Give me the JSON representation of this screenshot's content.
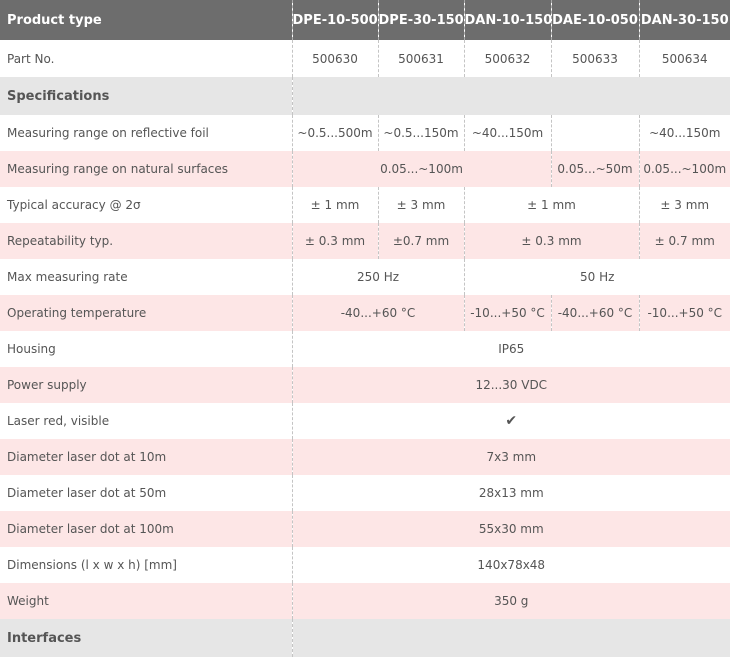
{
  "header": {
    "label": "Product type",
    "models": [
      "DPE-10-500",
      "DPE-30-150",
      "DAN-10-150",
      "DAE-10-050",
      "DAN-30-150"
    ]
  },
  "part_no": {
    "label": "Part No.",
    "values": [
      "500630",
      "500631",
      "500632",
      "500633",
      "500634"
    ]
  },
  "sections": {
    "specifications": "Specifications",
    "interfaces": "Interfaces"
  },
  "rows": {
    "reflective_range": {
      "label": "Measuring range on reflective foil",
      "v1": "~0.5...500m",
      "v2": "~0.5...150m",
      "v3": "~40...150m",
      "v4": "",
      "v5": "~40...150m"
    },
    "natural_range": {
      "label": "Measuring range on natural surfaces",
      "span123": "0.05...~100m",
      "v4": "0.05...~50m",
      "v5": "0.05...~100m"
    },
    "accuracy": {
      "label": "Typical accuracy @ 2σ",
      "v1": "± 1 mm",
      "v2": "± 3 mm",
      "span34": "± 1 mm",
      "v5": "± 3 mm"
    },
    "repeatability": {
      "label": "Repeatability typ.",
      "v1": "± 0.3 mm",
      "v2": "±0.7 mm",
      "span34": "± 0.3 mm",
      "v5": "± 0.7 mm"
    },
    "rate": {
      "label": "Max measuring rate",
      "span12": "250 Hz",
      "span345": "50 Hz"
    },
    "temperature": {
      "label": "Operating temperature",
      "span12": "-40...+60 °C",
      "v3": "-10...+50 °C",
      "v4": "-40...+60 °C",
      "v5": "-10...+50 °C"
    },
    "housing": {
      "label": "Housing",
      "all": "IP65"
    },
    "power": {
      "label": "Power supply",
      "all": "12...30 VDC"
    },
    "laser": {
      "label": "Laser red, visible",
      "all": "✔",
      "icon": "checkmark-icon"
    },
    "dot10": {
      "label": "Diameter laser dot at 10m",
      "all": "7x3 mm"
    },
    "dot50": {
      "label": "Diameter laser dot at 50m",
      "all": "28x13 mm"
    },
    "dot100": {
      "label": "Diameter laser dot at 100m",
      "all": "55x30 mm"
    },
    "dimensions": {
      "label": "Dimensions (l x w x h) [mm]",
      "all": "140x78x48"
    },
    "weight": {
      "label": "Weight",
      "all": "350 g"
    }
  }
}
